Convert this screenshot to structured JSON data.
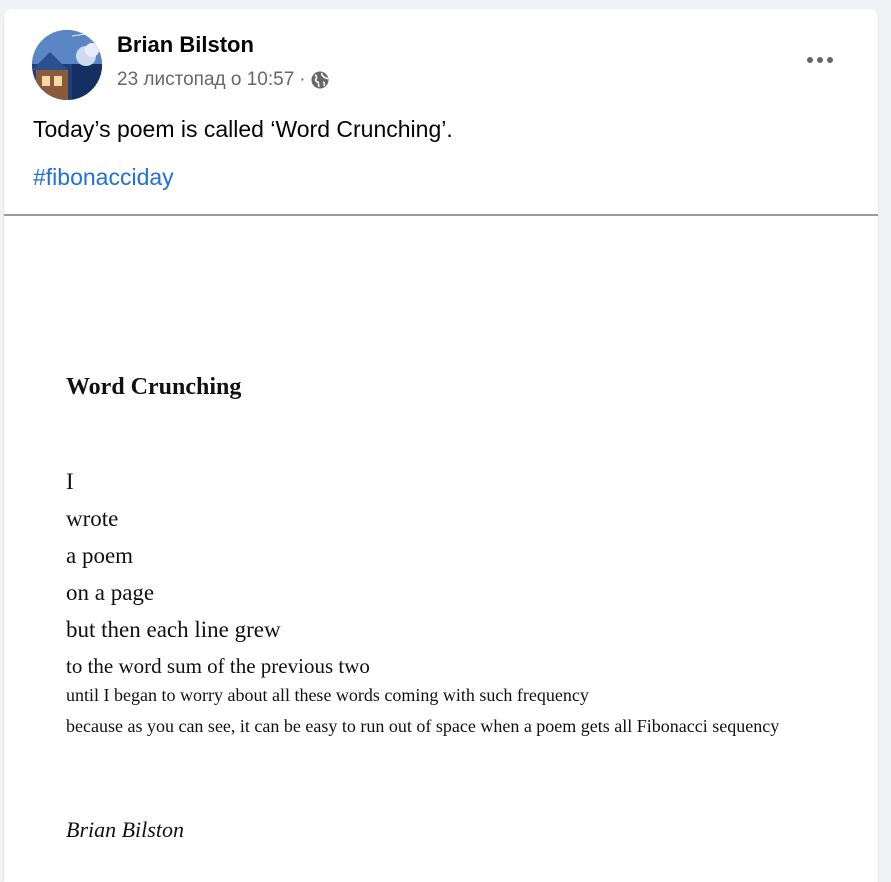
{
  "post": {
    "author": "Brian Bilston",
    "timestamp": "23 листопад о 10:57",
    "separator": "·",
    "audience_icon": "globe-icon",
    "more_icon": "more-horizontal-icon",
    "text": "Today’s poem is called ‘Word Crunching’.",
    "hashtag": "#fibonacciday",
    "colors": {
      "hashtag": "#216fdb",
      "meta": "#65676b",
      "author": "#050505"
    }
  },
  "poem": {
    "title": "Word Crunching",
    "lines": [
      "I",
      "wrote",
      "a poem",
      "on a page",
      "but then each line grew",
      "to the word sum of the previous two",
      "until I began to worry about all these words coming with such frequency",
      "because as you can see, it can be easy to run out of space when a poem gets all Fibonacci sequency"
    ],
    "signature": "Brian Bilston"
  }
}
